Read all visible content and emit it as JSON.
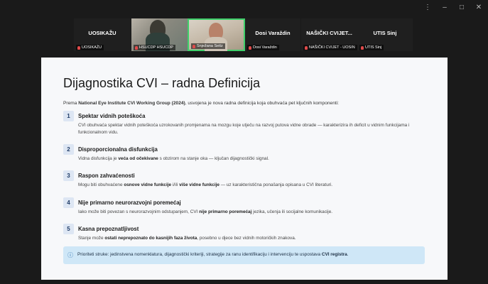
{
  "window_controls": [
    "⋮",
    "–",
    "□",
    "✕"
  ],
  "participants": [
    {
      "name": "UOSIKAŽU",
      "tag": "UOSIKAŽU",
      "video": false
    },
    {
      "name": "",
      "tag": "HSUCDP HSUCDP",
      "video": true
    },
    {
      "name": "",
      "tag": "Snježana Seitz",
      "video": true,
      "active": true
    },
    {
      "name": "Dosi Varaždin",
      "tag": "Dosi Varaždin",
      "video": false
    },
    {
      "name": "NAŠIČKI CVIJET...",
      "tag": "NAŠIČKI CVIJET - UOSIN",
      "video": false
    },
    {
      "name": "UTIS Sinj",
      "tag": "UTIS Sinj",
      "video": false
    }
  ],
  "slide": {
    "title": "Dijagnostika CVI – radna Definicija",
    "intro_pre": "Prema ",
    "intro_bold": "National Eye Institute CVI Working Group (2024)",
    "intro_post": ", usvojena je nova radna definicija koja obuhvaća pet ključnih komponenti:",
    "items": [
      {
        "num": "1",
        "title": "Spektar vidnih poteškoća",
        "text": "CVI obuhvaća spektar vidnih poteškoća uzrokovanih promjenama na mozgu koje utječu na razvoj putova vidne obrade — karakterizira ih deficit u vidnim funkcijama i funkcionalnom vidu."
      },
      {
        "num": "2",
        "title": "Disproporcionalna disfunkcija",
        "text_pre": "Vidna disfunkcija je ",
        "text_bold": "veća od očekivane",
        "text_post": " s obzirom na stanje oka — ključan dijagnostički signal."
      },
      {
        "num": "3",
        "title": "Raspon zahvaćenosti",
        "text_pre": "Mogu biti obuhvaćene ",
        "text_bold": "osnove vidne funkcije",
        "text_mid": " i/ili ",
        "text_bold2": "više vidne funkcije",
        "text_post": " — uz karakteristična ponašanja opisana u CVI literaturi."
      },
      {
        "num": "4",
        "title": "Nije primarno neurorazvojni poremećaj",
        "text_pre": "Iako može biti povezan s neurorazvojnim odstupanjem, CVI ",
        "text_bold": "nije primarno poremećaj",
        "text_post": " jezika, učenja ili socijalne komunikacije."
      },
      {
        "num": "5",
        "title": "Kasna prepoznatljivost",
        "text_pre": "Stanje može ",
        "text_bold": "ostati neprepoznato do kasnijih faza života",
        "text_post": ", posebno u djece bez vidnih motoričkih znakova."
      }
    ],
    "callout_icon": "ⓘ",
    "callout_pre": "Prioriteti struke: jedinstvena nomenklatura, dijagnostički kriteriji, strategije za ranu identifikaciju i intervenciju te uspostava ",
    "callout_bold": "CVI registra",
    "callout_post": "."
  }
}
